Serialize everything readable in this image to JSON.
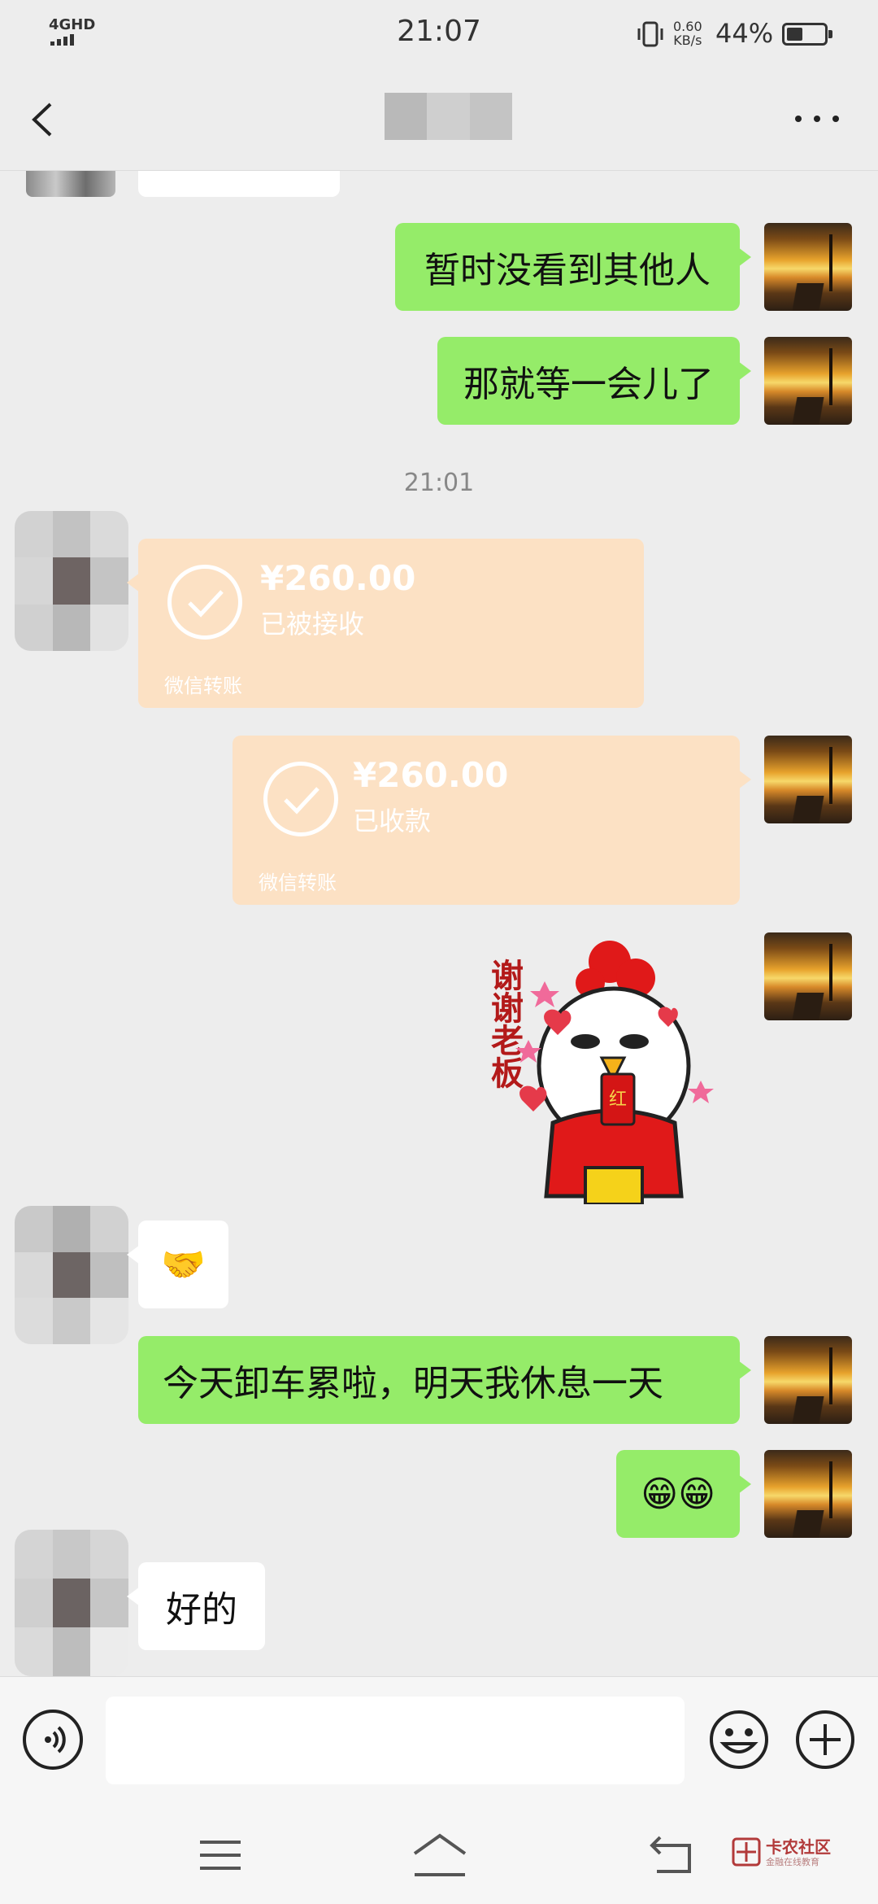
{
  "status_bar": {
    "network": "4GHD",
    "time": "21:07",
    "speed_value": "0.60",
    "speed_unit": "KB/s",
    "battery_percent": "44%",
    "battery_level": 0.44
  },
  "header": {
    "back_icon": "chevron-left-icon",
    "more_icon": "more-dots-icon"
  },
  "messages": [
    {
      "side": "me",
      "type": "text",
      "text": "暂时没看到其他人"
    },
    {
      "side": "me",
      "type": "text",
      "text": "那就等一会儿了"
    },
    {
      "type": "timestamp",
      "text": "21:01"
    },
    {
      "side": "other",
      "type": "transfer",
      "amount": "¥260.00",
      "status": "已被接收",
      "footer": "微信转账"
    },
    {
      "side": "me",
      "type": "transfer",
      "amount": "¥260.00",
      "status": "已收款",
      "footer": "微信转账"
    },
    {
      "side": "me",
      "type": "sticker",
      "caption": "谢谢老板",
      "badge": "红"
    },
    {
      "side": "other",
      "type": "emoji",
      "text": "🤝"
    },
    {
      "side": "me",
      "type": "text",
      "text": "今天卸车累啦，明天我休息一天"
    },
    {
      "side": "me",
      "type": "emoji",
      "text": "😁😁"
    },
    {
      "side": "other",
      "type": "text",
      "text": "好的"
    }
  ],
  "input_bar": {
    "value": "",
    "voice_icon": "voice-icon",
    "emoji_icon": "emoji-icon",
    "plus_icon": "plus-icon"
  },
  "system_nav": {
    "watermark_title": "卡农社区",
    "watermark_sub": "金融在线教育"
  },
  "colors": {
    "background": "#ededed",
    "bubble_me": "#95ec69",
    "bubble_other": "#ffffff",
    "transfer_received": "#fce1c4"
  }
}
